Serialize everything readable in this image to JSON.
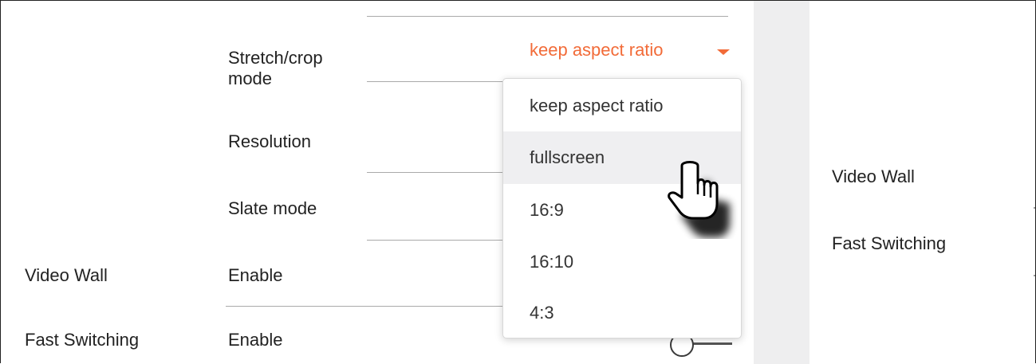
{
  "settings": {
    "stretch_label": "Stretch/crop\nmode",
    "stretch_value": "keep aspect ratio",
    "resolution_label": "Resolution",
    "slate_label": "Slate mode",
    "video_wall_section": "Video Wall",
    "video_wall_label": "Enable",
    "fast_switching_section": "Fast Switching",
    "fast_switching_label": "Enable"
  },
  "dropdown": {
    "options": [
      "keep aspect ratio",
      "fullscreen",
      "16:9",
      "16:10",
      "4:3"
    ],
    "hovered": "fullscreen"
  },
  "right_panel": {
    "video_wall": "Video Wall",
    "fast_switching": "Fast Switching"
  },
  "colors": {
    "accent": "#f26b38",
    "hover_bg": "#efeff1",
    "band_bg": "#eeeeef"
  },
  "icons": {
    "caret": "caret-down-icon",
    "cursor": "hand-pointer-icon"
  }
}
